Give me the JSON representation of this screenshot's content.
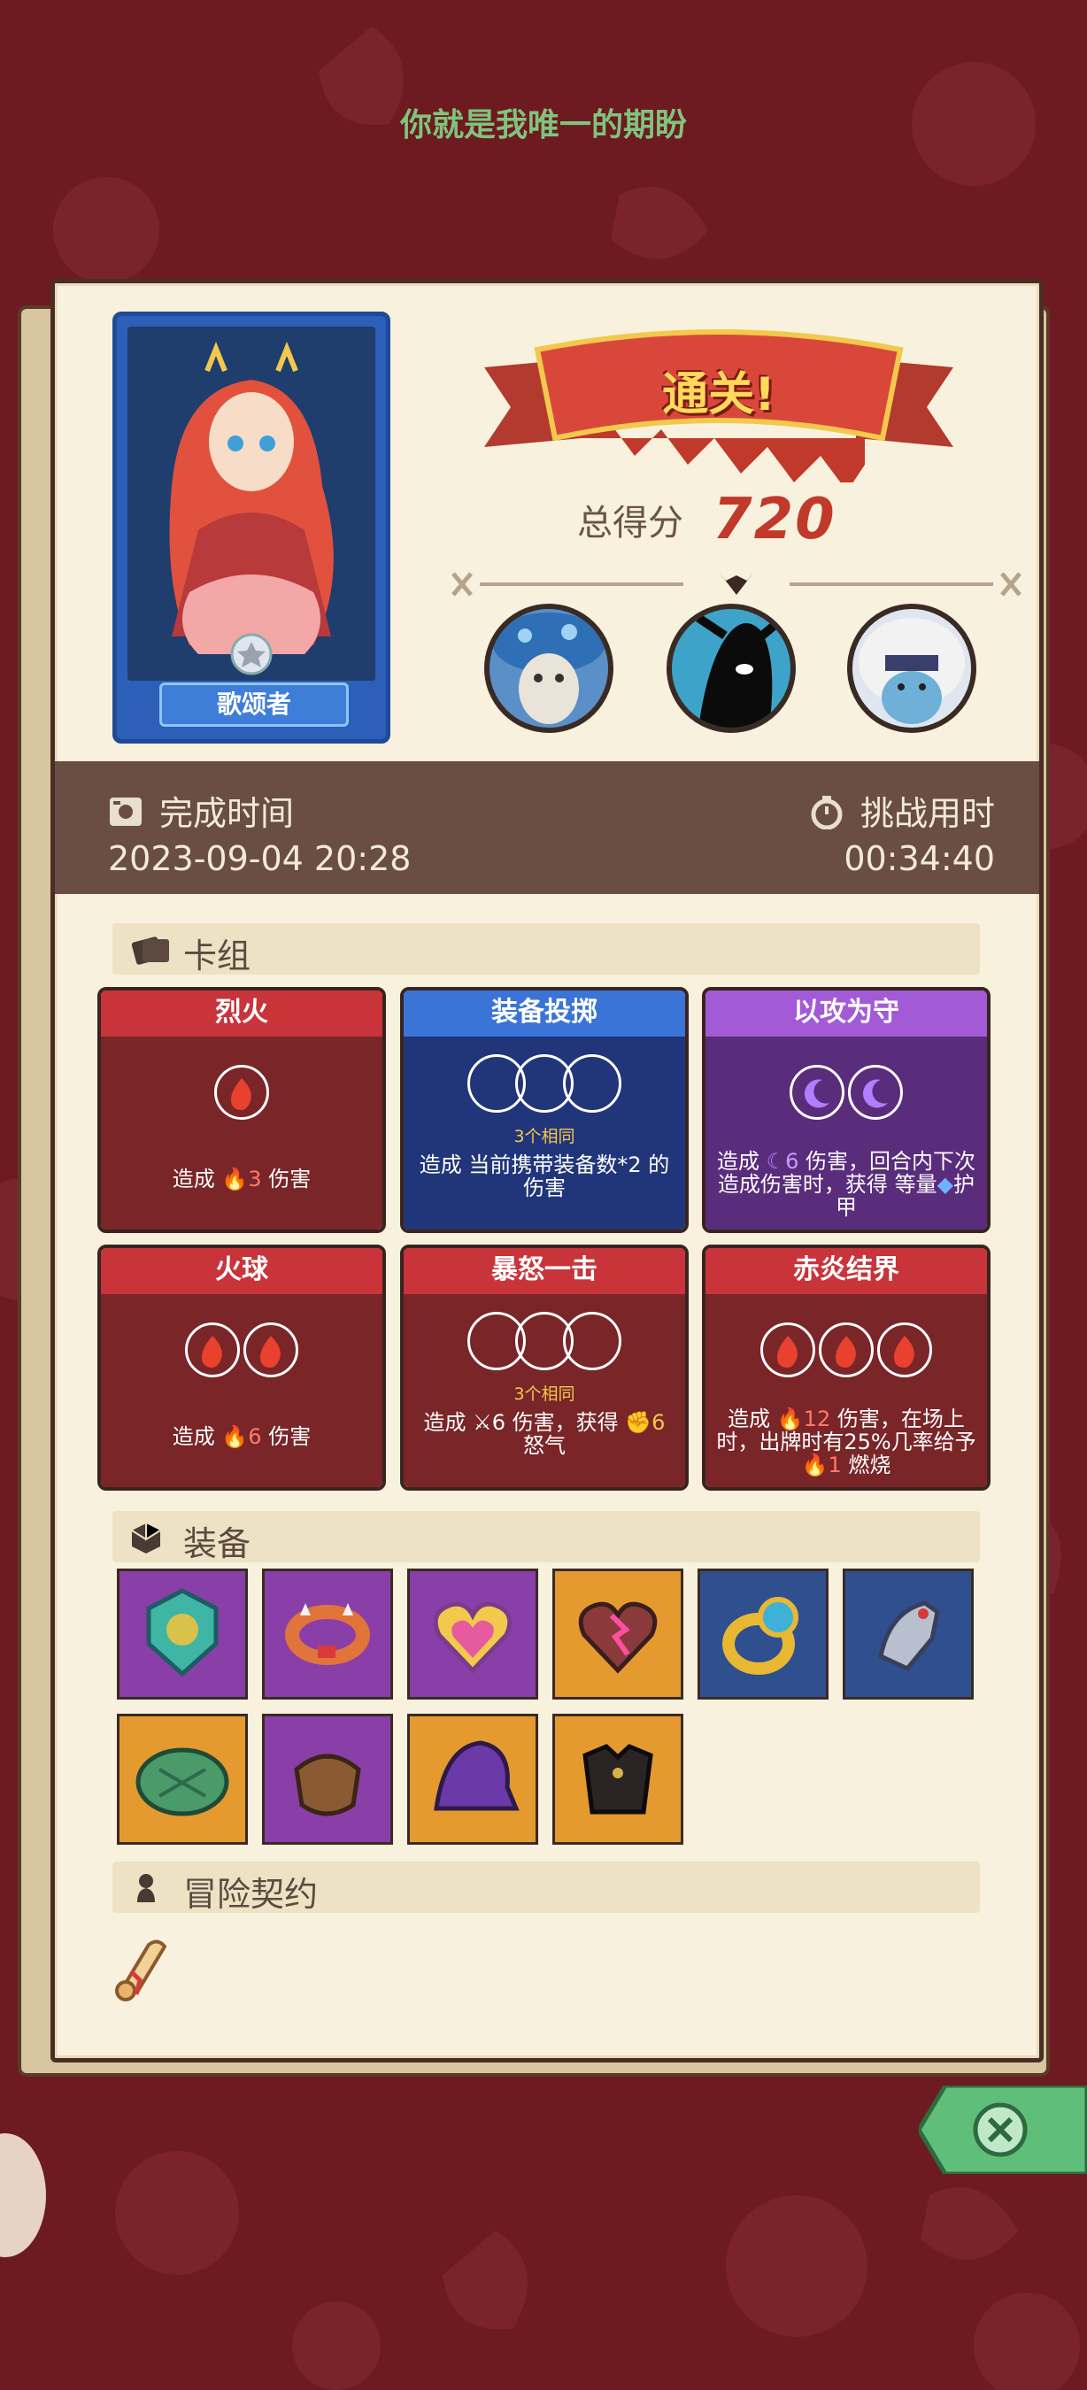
{
  "top_title": "你就是我唯一的期盼",
  "hero": {
    "name": "歌颂者"
  },
  "banner": {
    "text": "通关!"
  },
  "score": {
    "label": "总得分",
    "value": "720"
  },
  "info": {
    "complete_label": "完成时间",
    "complete_value": "2023-09-04 20:28",
    "duration_label": "挑战用时",
    "duration_value": "00:34:40"
  },
  "deck": {
    "title": "卡组",
    "cards": [
      {
        "name": "烈火",
        "color": "red",
        "orbs": 1,
        "orb_type": "fire",
        "prefix": "造成",
        "value": "3",
        "suffix": "伤害"
      },
      {
        "name": "装备投掷",
        "color": "blue",
        "orbs": 3,
        "orb_type": "empty",
        "same": "3个相同",
        "desc": "造成 当前携带装备数*2 的伤害"
      },
      {
        "name": "以攻为守",
        "color": "purple",
        "orbs": 2,
        "orb_type": "moon",
        "prefix": "造成",
        "value": "6",
        "mid": "伤害，回合内下次造成伤害时，获得 等量",
        "suffix": "护甲"
      },
      {
        "name": "火球",
        "color": "red",
        "orbs": 2,
        "orb_type": "fire",
        "prefix": "造成",
        "value": "6",
        "suffix": "伤害"
      },
      {
        "name": "暴怒一击",
        "color": "red",
        "orbs": 3,
        "orb_type": "empty",
        "same": "3个相同",
        "prefix": "造成",
        "value": "6",
        "mid": "伤害，获得",
        "value2": "6",
        "suffix": "怒气"
      },
      {
        "name": "赤炎结界",
        "color": "red",
        "orbs": 3,
        "orb_type": "fire",
        "prefix": "造成",
        "value": "12",
        "mid": "伤害，在场上时，出牌时有25%几率给予",
        "value2": "1",
        "suffix": "燃烧"
      }
    ]
  },
  "equipment": {
    "title": "装备",
    "items": [
      {
        "icon": "lion-amulet-icon",
        "bg": "purple"
      },
      {
        "icon": "spiked-bracelet-icon",
        "bg": "purple"
      },
      {
        "icon": "heart-pendant-icon",
        "bg": "purple"
      },
      {
        "icon": "cursed-heart-icon",
        "bg": "orange"
      },
      {
        "icon": "gold-ring-icon",
        "bg": "blue"
      },
      {
        "icon": "steel-gauntlet-icon",
        "bg": "blue"
      },
      {
        "icon": "turtle-shell-icon",
        "bg": "orange"
      },
      {
        "icon": "leather-bracer-icon",
        "bg": "purple"
      },
      {
        "icon": "purple-hood-icon",
        "bg": "purple"
      },
      {
        "icon": "dark-armor-icon",
        "bg": "orange"
      }
    ]
  },
  "contract": {
    "title": "冒险契约"
  },
  "colors": {
    "background": "#6d1a20",
    "paper": "#f8f1dd",
    "accent_red": "#c8343a",
    "accent_blue": "#3a74d6",
    "accent_purple": "#a35ad6",
    "score": "#c0392b",
    "title_green": "#7fc47d"
  }
}
